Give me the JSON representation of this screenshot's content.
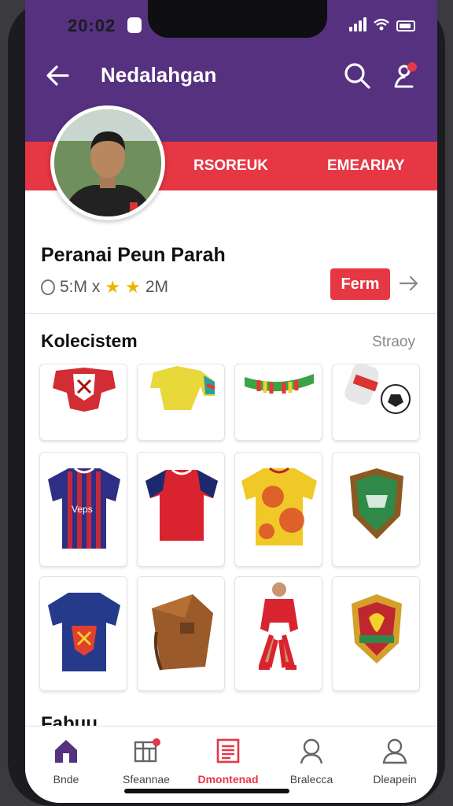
{
  "status_bar": {
    "time": "20:02"
  },
  "header": {
    "title": "Nedalahgan"
  },
  "tabs": [
    {
      "label": "RSOREUK"
    },
    {
      "label": "EMEARIAY"
    }
  ],
  "profile": {
    "name": "Peranai Peun Parah",
    "stat_one": "5:M x",
    "stat_two": "2M",
    "follow_label": "Ferm"
  },
  "collection": {
    "title": "Kolecistem",
    "link": "Straoy"
  },
  "items": [
    {
      "icon": "red-crest-icon"
    },
    {
      "icon": "yellow-jersey-icon"
    },
    {
      "icon": "striped-scarf-icon"
    },
    {
      "icon": "can-and-ball-icon"
    },
    {
      "icon": "purple-striped-jersey-icon"
    },
    {
      "icon": "red-jersey-icon"
    },
    {
      "icon": "yellow-red-jersey-icon"
    },
    {
      "icon": "green-shield-icon"
    },
    {
      "icon": "navy-jersey-icon"
    },
    {
      "icon": "leather-bag-icon"
    },
    {
      "icon": "player-figure-icon"
    },
    {
      "icon": "red-shield-icon"
    }
  ],
  "next_section": {
    "title": "Fabuu"
  },
  "bottom_nav": [
    {
      "label": "Bnde",
      "icon": "home-icon"
    },
    {
      "label": "Sfeannae",
      "icon": "grid-icon"
    },
    {
      "label": "Dmontenad",
      "icon": "document-icon"
    },
    {
      "label": "Bralecca",
      "icon": "profile-icon"
    },
    {
      "label": "Dleapein",
      "icon": "user-icon"
    }
  ],
  "colors": {
    "primary": "#55317f",
    "accent": "#e53744",
    "star": "#f0b400"
  }
}
